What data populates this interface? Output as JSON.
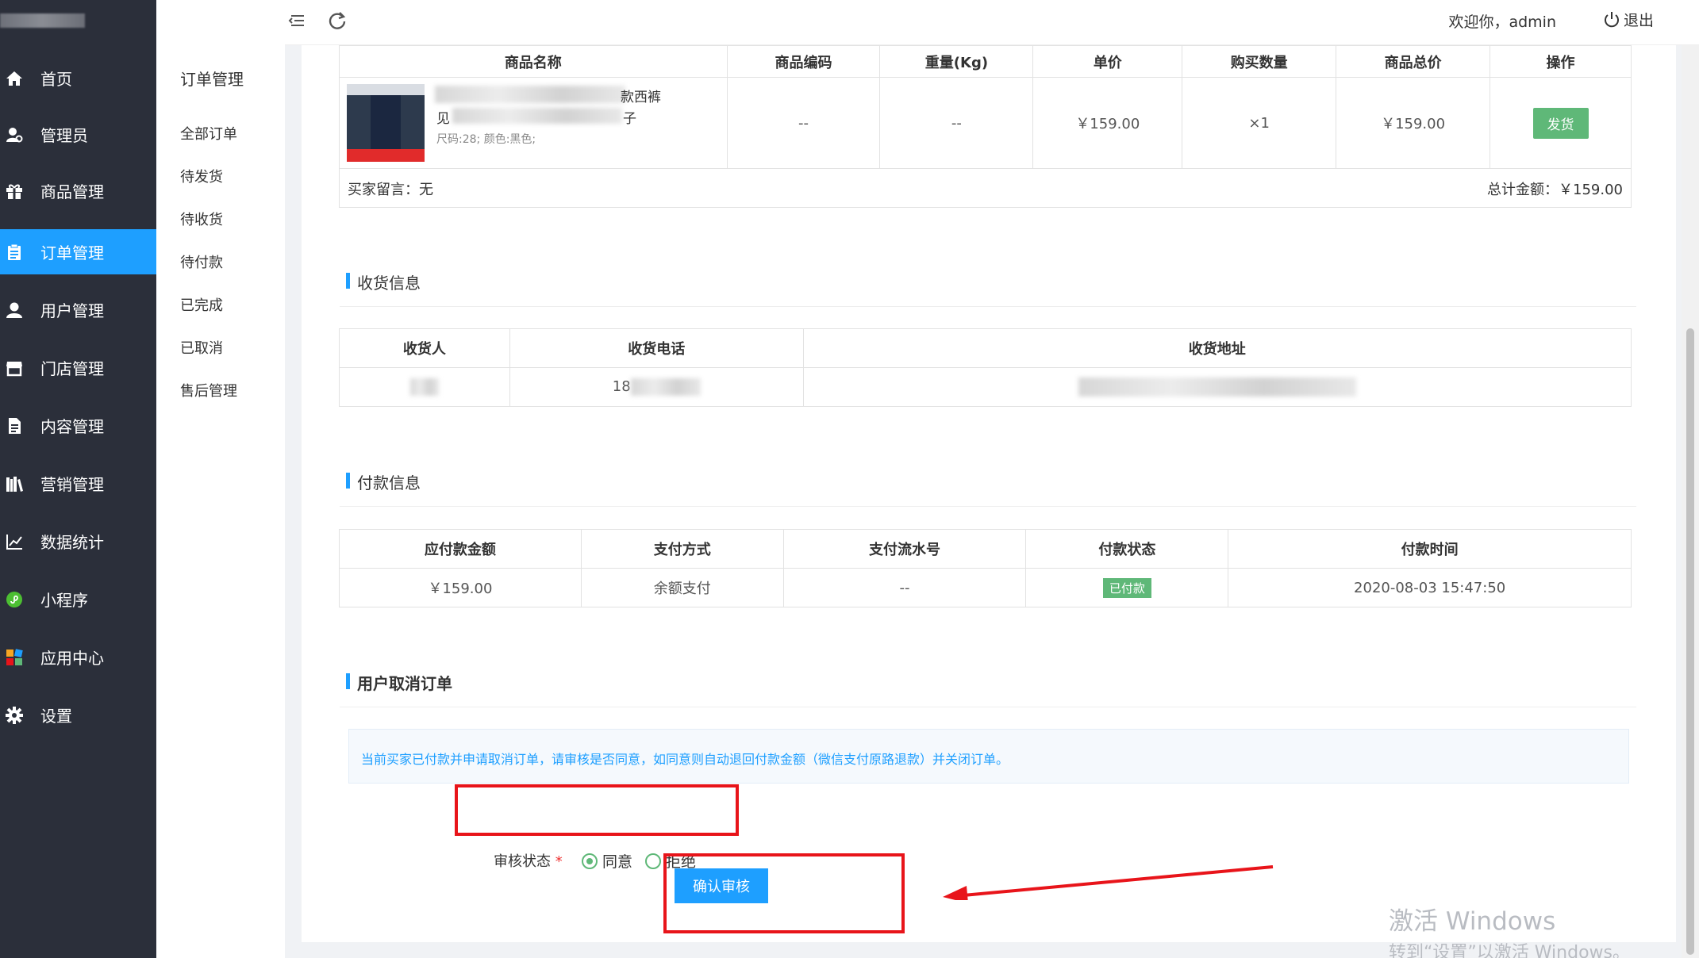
{
  "sidebar": {
    "items": [
      {
        "label": "首页",
        "icon": "home-icon"
      },
      {
        "label": "管理员",
        "icon": "admin-icon"
      },
      {
        "label": "商品管理",
        "icon": "gift-icon"
      },
      {
        "label": "订单管理",
        "icon": "clipboard-icon",
        "active": true
      },
      {
        "label": "用户管理",
        "icon": "user-icon"
      },
      {
        "label": "门店管理",
        "icon": "store-icon"
      },
      {
        "label": "内容管理",
        "icon": "document-icon"
      },
      {
        "label": "营销管理",
        "icon": "books-icon"
      },
      {
        "label": "数据统计",
        "icon": "chart-icon"
      },
      {
        "label": "小程序",
        "icon": "miniprogram-icon"
      },
      {
        "label": "应用中心",
        "icon": "apps-icon"
      },
      {
        "label": "设置",
        "icon": "gear-icon"
      }
    ]
  },
  "submenu": {
    "title": "订单管理",
    "items": [
      "全部订单",
      "待发货",
      "待收货",
      "待付款",
      "已完成",
      "已取消",
      "售后管理"
    ]
  },
  "header": {
    "welcome": "欢迎你，admin",
    "logout": "退出"
  },
  "product_table": {
    "headers": [
      "商品名称",
      "商品编码",
      "重量(Kg)",
      "单价",
      "购买数量",
      "商品总价",
      "操作"
    ],
    "row": {
      "name_visible_1": "款西裤",
      "name_visible_2": "子",
      "name_visible_prefix": "见",
      "spec": "尺码:28; 颜色:黑色;",
      "code": "--",
      "weight": "--",
      "unit_price": "￥159.00",
      "quantity": "×1",
      "total_price": "￥159.00",
      "action": "发货"
    },
    "buyer_note": "买家留言：无",
    "total_label": "总计金额：",
    "total_value": "￥159.00"
  },
  "shipping": {
    "title": "收货信息",
    "headers": [
      "收货人",
      "收货电话",
      "收货地址"
    ],
    "phone_prefix": "18"
  },
  "payment": {
    "title": "付款信息",
    "headers": [
      "应付款金额",
      "支付方式",
      "支付流水号",
      "付款状态",
      "付款时间"
    ],
    "row": {
      "amount": "￥159.00",
      "method": "余额支付",
      "serial": "--",
      "status": "已付款",
      "time": "2020-08-03 15:47:50"
    }
  },
  "cancel": {
    "title": "用户取消订单",
    "notice": "当前买家已付款并申请取消订单，请审核是否同意，如同意则自动退回付款金额（微信支付原路退款）并关闭订单。",
    "audit_label": "审核状态",
    "required_mark": "*",
    "option_agree": "同意",
    "option_reject": "拒绝",
    "confirm": "确认审核"
  },
  "watermark": {
    "line1": "激活 Windows",
    "line2": "转到“设置”以激活 Windows。"
  },
  "colors": {
    "sidebar_bg": "#2b2f3a",
    "accent": "#1e9fff",
    "success": "#5fb878",
    "annotation": "#e8141a"
  }
}
